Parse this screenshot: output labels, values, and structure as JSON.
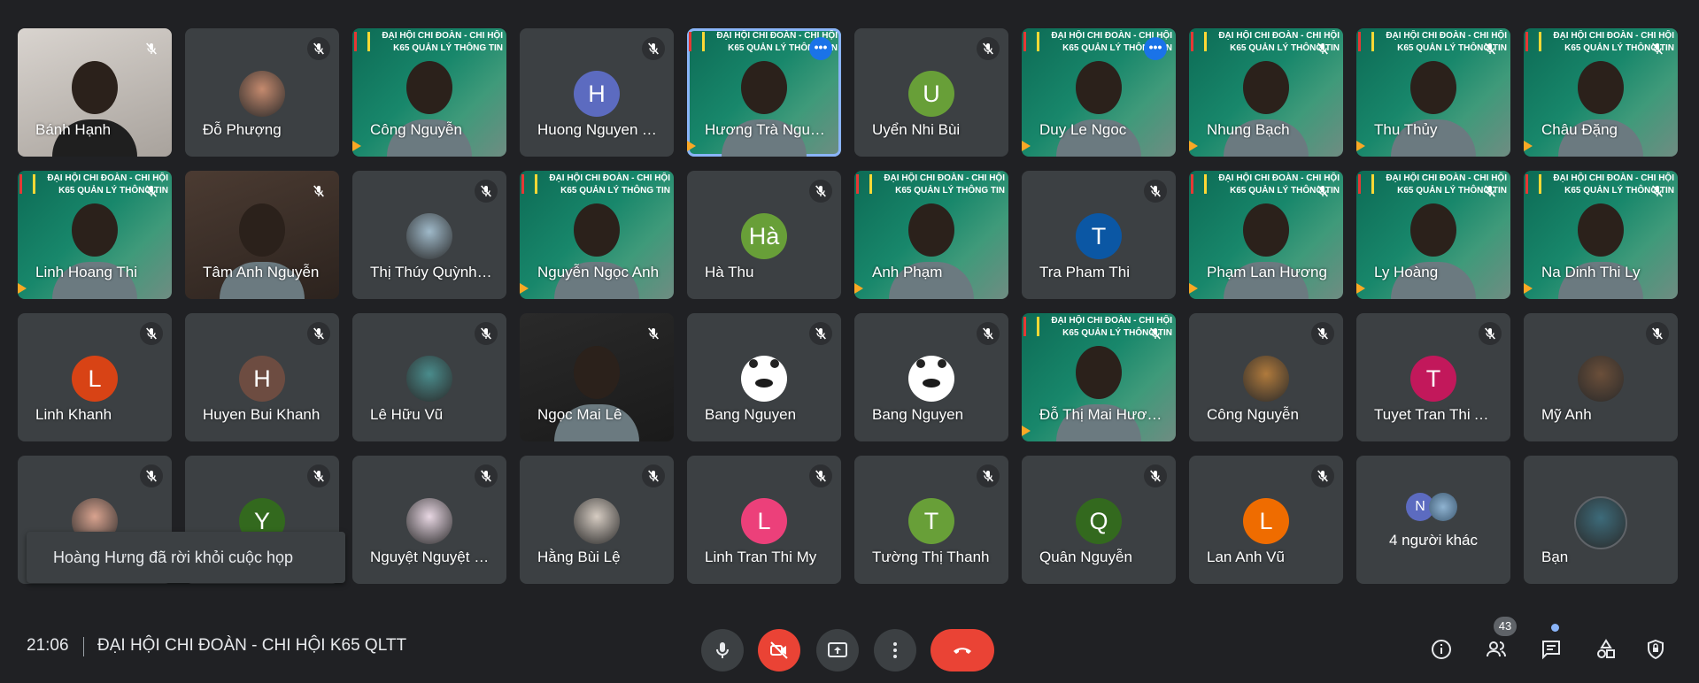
{
  "colors": {
    "background": "#202124",
    "tile": "#3c4043",
    "accent_active": "#8ab4f8",
    "end_call": "#ea4335",
    "speaking": "#1a73e8"
  },
  "banner_text": [
    "ĐẠI HỘI CHI ĐOÀN - CHI HỘI",
    "K65 QUẢN LÝ THÔNG TIN"
  ],
  "tiles": [
    {
      "name": "Bánh Hạnh",
      "type": "video",
      "bg": "light",
      "muted": true
    },
    {
      "name": "Đỗ Phượng",
      "type": "photo",
      "photo": "#c58a6e",
      "muted": true
    },
    {
      "name": "Công Nguyễn",
      "type": "video",
      "bg": "green",
      "banner": true,
      "muted": false
    },
    {
      "name": "Huong Nguyen Thi",
      "type": "letter",
      "letter": "H",
      "color": "#5c6bc0",
      "muted": true
    },
    {
      "name": "Hương Trà Nguyễn",
      "type": "video",
      "bg": "green",
      "banner": true,
      "active": true,
      "speaking": true,
      "muted": false
    },
    {
      "name": "Uyển Nhi Bùi",
      "type": "letter",
      "letter": "U",
      "color": "#689f38",
      "muted": true
    },
    {
      "name": "Duy Le Ngoc",
      "type": "video",
      "bg": "green",
      "banner": true,
      "speaking": true,
      "muted": false
    },
    {
      "name": "Nhung Bạch",
      "type": "video",
      "bg": "green",
      "banner": true,
      "muted": true
    },
    {
      "name": "Thu Thủy",
      "type": "video",
      "bg": "green",
      "banner": true,
      "muted": true
    },
    {
      "name": "Châu Đặng",
      "type": "video",
      "bg": "green",
      "banner": true,
      "muted": true
    },
    {
      "name": "Linh Hoang Thi",
      "type": "video",
      "bg": "green",
      "banner": true,
      "muted": true
    },
    {
      "name": "Tâm Anh Nguyễn",
      "type": "video",
      "bg": "room",
      "muted": true
    },
    {
      "name": "Thị Thúy Quỳnh Nguyễn",
      "type": "photo",
      "photo": "#9fb9c9",
      "muted": true
    },
    {
      "name": "Nguyễn Ngọc Anh",
      "type": "video",
      "bg": "green",
      "banner": true,
      "muted": false
    },
    {
      "name": "Hà Thu",
      "type": "letter",
      "letter": "Hà",
      "color": "#689f38",
      "muted": true
    },
    {
      "name": "Anh Phạm",
      "type": "video",
      "bg": "green",
      "banner": true,
      "muted": false
    },
    {
      "name": "Tra Pham Thi",
      "type": "letter",
      "letter": "T",
      "color": "#0b57a4",
      "muted": true
    },
    {
      "name": "Phạm Lan Hương",
      "type": "video",
      "bg": "green",
      "banner": true,
      "muted": true
    },
    {
      "name": "Ly Hoàng",
      "type": "video",
      "bg": "green",
      "banner": true,
      "muted": true
    },
    {
      "name": "Na Dinh Thi Ly",
      "type": "video",
      "bg": "green",
      "banner": true,
      "muted": true
    },
    {
      "name": "Linh Khanh",
      "type": "letter",
      "letter": "L",
      "color": "#d84315",
      "muted": true
    },
    {
      "name": "Huyen Bui Khanh",
      "type": "letter",
      "letter": "H",
      "color": "#6d4c41",
      "muted": true
    },
    {
      "name": "Lê Hữu Vũ",
      "type": "photo",
      "photo": "#4a8c8c",
      "muted": true
    },
    {
      "name": "Ngọc Mai Lê",
      "type": "video",
      "bg": "dark",
      "muted": true
    },
    {
      "name": "Bang Nguyen",
      "type": "bear",
      "muted": true
    },
    {
      "name": "Bang Nguyen",
      "type": "bear",
      "muted": true
    },
    {
      "name": "Đỗ Thị Mai Hương",
      "type": "video",
      "bg": "green",
      "banner": true,
      "muted": true
    },
    {
      "name": "Công Nguyễn",
      "type": "photo",
      "photo": "#b07a3c",
      "muted": true
    },
    {
      "name": "Tuyet Tran Thi Anh",
      "type": "letter",
      "letter": "T",
      "color": "#c2185b",
      "muted": true
    },
    {
      "name": "Mỹ Anh",
      "type": "photo",
      "photo": "#6b4f3a",
      "muted": true
    },
    {
      "name": "",
      "type": "photo",
      "photo": "#d9a38f",
      "muted": true
    },
    {
      "name": "",
      "type": "letter",
      "letter": "Y",
      "color": "#33691e",
      "muted": true
    },
    {
      "name": "Nguyệt Nguyệt Nguyễn",
      "type": "photo",
      "photo": "#e8d7e3",
      "muted": true
    },
    {
      "name": "Hằng Bùi Lệ",
      "type": "photo",
      "photo": "#d6ccc2",
      "muted": true
    },
    {
      "name": "Linh Tran Thi My",
      "type": "letter",
      "letter": "L",
      "color": "#ec407a",
      "muted": true
    },
    {
      "name": "Tường Thị Thanh",
      "type": "letter",
      "letter": "T",
      "color": "#689f38",
      "muted": true
    },
    {
      "name": "Quân Nguyễn",
      "type": "letter",
      "letter": "Q",
      "color": "#33691e",
      "muted": true
    },
    {
      "name": "Lan Anh Vũ",
      "type": "letter",
      "letter": "L",
      "color": "#ef6c00",
      "muted": true
    },
    {
      "name": "4 người khác",
      "type": "others",
      "letters": [
        "N"
      ],
      "muted": false
    },
    {
      "name": "Bạn",
      "type": "photo",
      "photo": "#3d6b7a",
      "muted": false,
      "self": true
    }
  ],
  "toast": "Hoàng Hưng đã rời khỏi cuộc họp",
  "bottom": {
    "time": "21:06",
    "meeting_title": "ĐẠI HỘI CHI ĐOÀN - CHI HỘI K65 QLTT",
    "participant_count": "43"
  },
  "icons": {
    "mic": "mic-icon",
    "camera_off": "camera-off-icon",
    "present": "present-screen-icon",
    "more": "more-options-icon",
    "end_call": "end-call-icon",
    "info": "info-icon",
    "people": "people-icon",
    "chat": "chat-icon",
    "activities": "activities-icon",
    "host_controls": "host-controls-icon"
  }
}
